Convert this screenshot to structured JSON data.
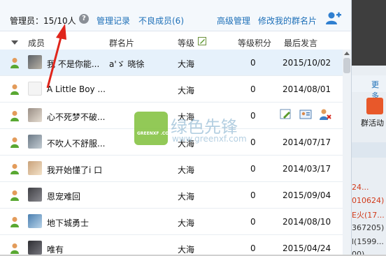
{
  "topbar": {
    "admin_count": "管理员：15/10人",
    "help_glyph": "?",
    "manage_log": "管理记录",
    "bad_members": "不良成员(6)",
    "advanced": "高级管理",
    "edit_card": "修改我的群名片"
  },
  "columns": {
    "member": "成员",
    "card": "群名片",
    "level": "等级",
    "score": "等级积分",
    "last_post": "最后发言"
  },
  "rows": [
    {
      "name": "我 不是你能...",
      "card": "a'ゞ 晓徐",
      "level": "大海",
      "score": "0",
      "last": "2015/10/02",
      "selected": true
    },
    {
      "name": "A Little Boy ...",
      "card": "",
      "level": "大海",
      "score": "0",
      "last": "2014/08/01"
    },
    {
      "name": "心不死梦不破...",
      "card": "",
      "level": "大海",
      "score": "0",
      "last": ""
    },
    {
      "name": "不吹人不舒服...",
      "card": "",
      "level": "大海",
      "score": "0",
      "last": "2014/07/17"
    },
    {
      "name": "我开始懂了i 口",
      "card": "",
      "level": "大海",
      "score": "0",
      "last": "2014/03/17"
    },
    {
      "name": "恩宠难回",
      "card": "",
      "level": "大海",
      "score": "0",
      "last": "2015/09/04"
    },
    {
      "name": "地下城勇士",
      "card": "",
      "level": "大海",
      "score": "0",
      "last": "2014/08/10"
    },
    {
      "name": "唯有",
      "card": "",
      "level": "大海",
      "score": "0",
      "last": "2015/04/24"
    }
  ],
  "side": {
    "more": "更多",
    "tile_label": "群活动",
    "s1": "24...",
    "s2": "010624)",
    "s3": "E火(17...",
    "s4": "367205)",
    "s5": "l(1599...",
    "s6": "00)"
  },
  "watermark": {
    "title": "绿色先锋",
    "url": "www.greenxf.com",
    "box_text": "GREENXF .COM"
  },
  "colors": {
    "accent_link": "#1d6fb8",
    "selected_row": "#e6f1fb",
    "annotation_arrow": "#e0251b"
  }
}
